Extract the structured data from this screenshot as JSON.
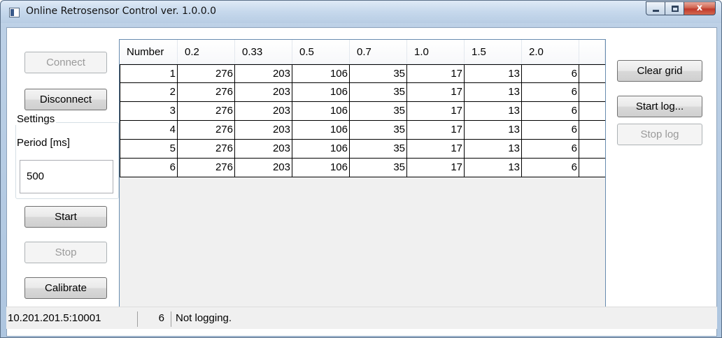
{
  "window": {
    "title": "Online Retrosensor Control ver. 1.0.0.0",
    "close_glyph": "x"
  },
  "left_panel": {
    "connect_label": "Connect",
    "disconnect_label": "Disconnect",
    "settings_label": "Settings",
    "period_label": "Period [ms]",
    "period_value": "500",
    "start_label": "Start",
    "stop_label": "Stop",
    "calibrate_label": "Calibrate"
  },
  "right_panel": {
    "clear_grid_label": "Clear grid",
    "start_log_label": "Start log...",
    "stop_log_label": "Stop log"
  },
  "grid": {
    "columns": [
      "Number",
      "0.2",
      "0.33",
      "0.5",
      "0.7",
      "1.0",
      "1.5",
      "2.0"
    ],
    "rows": [
      [
        "1",
        "276",
        "203",
        "106",
        "35",
        "17",
        "13",
        "6"
      ],
      [
        "2",
        "276",
        "203",
        "106",
        "35",
        "17",
        "13",
        "6"
      ],
      [
        "3",
        "276",
        "203",
        "106",
        "35",
        "17",
        "13",
        "6"
      ],
      [
        "4",
        "276",
        "203",
        "106",
        "35",
        "17",
        "13",
        "6"
      ],
      [
        "5",
        "276",
        "203",
        "106",
        "35",
        "17",
        "13",
        "6"
      ],
      [
        "6",
        "276",
        "203",
        "106",
        "35",
        "17",
        "13",
        "6"
      ]
    ]
  },
  "statusbar": {
    "address": "10.201.201.5:10001",
    "count": "6",
    "log_status": "Not logging."
  }
}
